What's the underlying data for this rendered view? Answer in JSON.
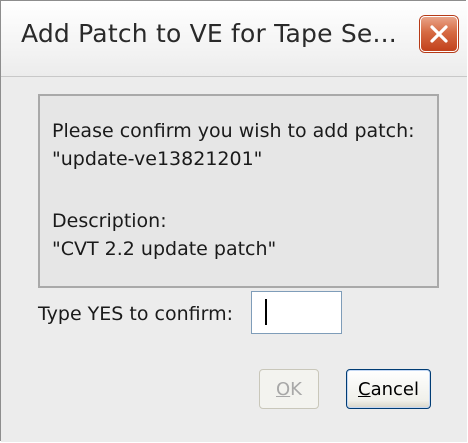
{
  "window": {
    "title": "Add Patch to VE for Tape Se..."
  },
  "message": {
    "line1": "Please confirm you wish to add patch:",
    "line2": "\"update-ve13821201\"",
    "line3": "Description:",
    "line4": "\"CVT 2.2 update patch\""
  },
  "confirm": {
    "label": "Type YES to confirm:",
    "value": ""
  },
  "buttons": {
    "ok_first": "O",
    "ok_rest": "K",
    "cancel_first": "C",
    "cancel_rest": "ancel"
  },
  "icons": {
    "close": "close-icon"
  },
  "colors": {
    "close_button": "#d66a43",
    "dialog_background": "#ececec",
    "default_button_border": "#003c74"
  }
}
